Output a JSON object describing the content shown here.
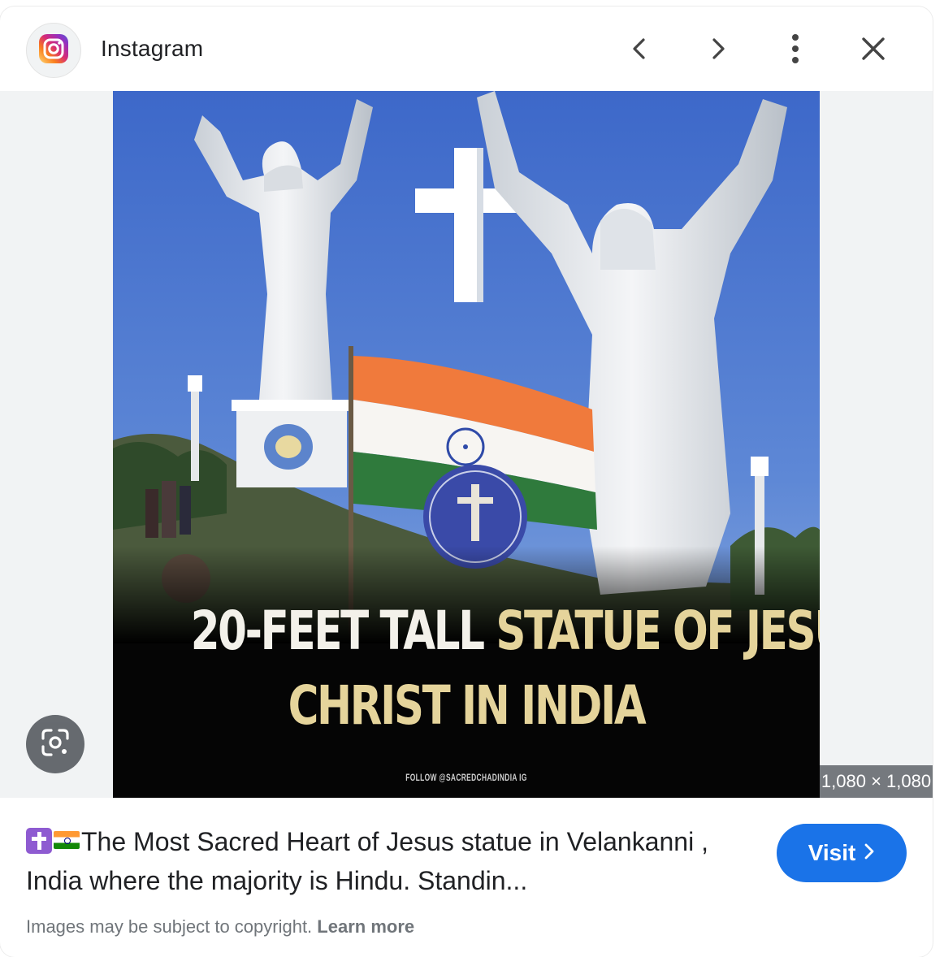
{
  "header": {
    "site_name": "Instagram",
    "icons": {
      "site": "instagram-logo-icon",
      "prev": "chevron-left-icon",
      "next": "chevron-right-icon",
      "more": "more-vert-icon",
      "close": "close-icon"
    }
  },
  "image": {
    "caption_line1_white": "20-FEET TALL ",
    "caption_line1_gold": "STATUE OF JESUS",
    "caption_line2": "CHRIST IN INDIA",
    "follow_text": "FOLLOW @SACREDCHADINDIA IG",
    "dimensions": "1,080 × 1,080",
    "lens_icon": "google-lens-icon"
  },
  "result": {
    "title_text": "The Most Sacred Heart of Jesus statue in Velankanni , India where the majority is Hindu. Standin...",
    "title_emojis": [
      "latin-cross-emoji",
      "india-flag-emoji"
    ],
    "visit_label": "Visit",
    "copyright_text": "Images may be subject to copyright.",
    "learn_more": "Learn more"
  },
  "colors": {
    "visit_button": "#1a73e8",
    "caption_gold": "#e5d49b",
    "sky": "#3d68c9"
  }
}
